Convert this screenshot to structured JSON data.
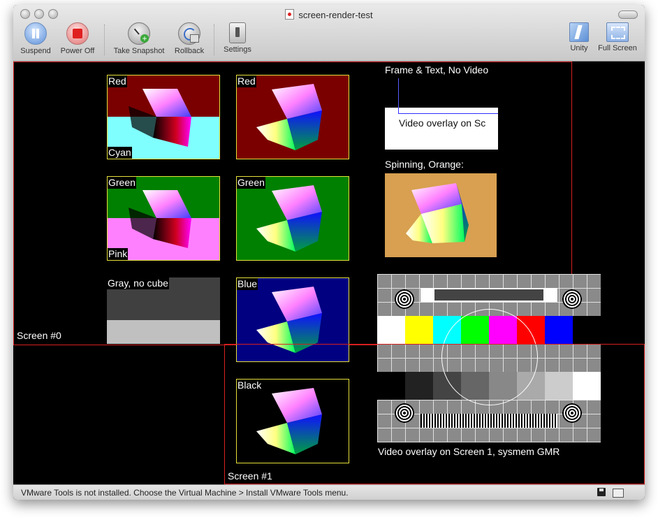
{
  "window": {
    "title": "screen-render-test"
  },
  "toolbar": {
    "suspend": "Suspend",
    "power_off": "Power Off",
    "take_snapshot": "Take Snapshot",
    "rollback": "Rollback",
    "settings": "Settings",
    "unity": "Unity",
    "full_screen": "Full Screen"
  },
  "screen0": {
    "label": "Screen #0",
    "tiles": {
      "red_split": {
        "top": "Red",
        "bottom": "Cyan"
      },
      "red": "Red",
      "green_split": {
        "top": "Green",
        "bottom": "Pink"
      },
      "green": "Green",
      "gray": "Gray, no cube",
      "blue": "Blue"
    },
    "frame_text": "Frame & Text, No Video",
    "video_overlay_clip": "Video overlay on Sc",
    "spinning": "Spinning, Orange:"
  },
  "screen1": {
    "label": "Screen #1",
    "black_tile": "Black",
    "video_overlay_caption": "Video overlay on Screen 1, sysmem GMR"
  },
  "statusbar": {
    "message": "VMware Tools is not installed. Choose the Virtual Machine > Install VMware Tools menu."
  },
  "colors": {
    "screen_border": "#d81f1f",
    "tile_border": "#e6e03a",
    "red": "#7a0000",
    "cyan": "#80ffff",
    "green": "#008000",
    "pink": "#ff80ff",
    "blue": "#000080",
    "orange": "#d8a050",
    "gray_dark": "#404040",
    "gray_light": "#c0c0c0"
  },
  "icons": [
    "suspend-icon",
    "power-off-icon",
    "take-snapshot-icon",
    "rollback-icon",
    "settings-icon",
    "unity-icon",
    "full-screen-icon",
    "disk-icon",
    "shared-folder-icon"
  ]
}
